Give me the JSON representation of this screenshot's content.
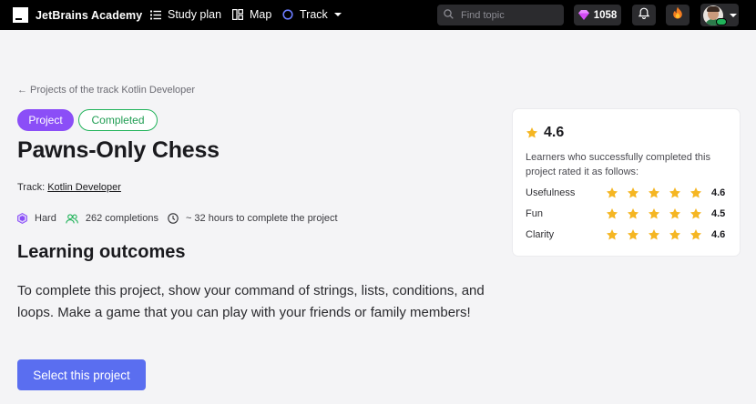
{
  "topbar": {
    "brand": "JetBrains Academy",
    "nav": {
      "study_plan": "Study plan",
      "map": "Map",
      "track": "Track"
    },
    "search_placeholder": "Find topic",
    "gems": "1058"
  },
  "breadcrumb": "← Projects of the track Kotlin Developer",
  "tags": {
    "project": "Project",
    "completed": "Completed"
  },
  "project": {
    "title": "Pawns-Only Chess",
    "track_label": "Track:",
    "track_name": "Kotlin Developer",
    "difficulty": "Hard",
    "completions": "262 completions",
    "duration": "~ 32 hours to complete the project"
  },
  "outcomes": {
    "heading": "Learning outcomes",
    "description": "To complete this project, show your command of strings, lists, conditions, and loops. Make a game that you can play with your friends or family members!",
    "cta": "Select this project"
  },
  "rating": {
    "overall": "4.6",
    "note": "Learners who successfully completed this project rated it as follows:",
    "rows": [
      {
        "label": "Usefulness",
        "value": "4.6",
        "stars": 5
      },
      {
        "label": "Fun",
        "value": "4.5",
        "stars": 5
      },
      {
        "label": "Clarity",
        "value": "4.6",
        "stars": 5
      }
    ]
  },
  "colors": {
    "accent_purple": "#8b4ef7",
    "success_green": "#21b35a",
    "button_blue": "#5a6ef0",
    "star_yellow": "#f5b623"
  }
}
